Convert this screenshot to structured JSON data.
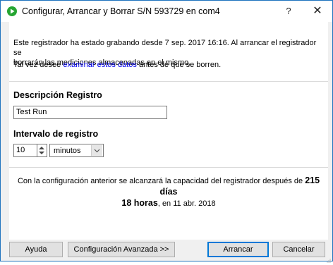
{
  "window": {
    "title": "Configurar, Arrancar y Borrar S/N 593729 en com4",
    "help_glyph": "?",
    "close_glyph": "✕",
    "icon": "play-icon",
    "accent_color": "#1e73be"
  },
  "notice": {
    "line1": "Este registrador ha estado grabando desde 7 sep. 2017 16:16. Al arrancar el registrador se",
    "line2": "borrarán las mediciones almacenadas en el mismo.",
    "suggest_prefix": "Tal vez desee ",
    "suggest_link": "examinar estos datos",
    "suggest_suffix": " antes de que se borren."
  },
  "description": {
    "heading": "Descripción Registro",
    "value": "Test Run"
  },
  "interval": {
    "heading": "Intervalo de registro",
    "value": "10",
    "unit": "minutos"
  },
  "capacity": {
    "prefix": "Con la configuración anterior se alcanzará la capacidad del registrador después de ",
    "duration_days": "215 días",
    "duration_hours": "18 horas",
    "suffix": ", en 11 abr. 2018"
  },
  "buttons": {
    "help": "Ayuda",
    "advanced": "Configuración Avanzada >>",
    "start": "Arrancar",
    "cancel": "Cancelar"
  }
}
